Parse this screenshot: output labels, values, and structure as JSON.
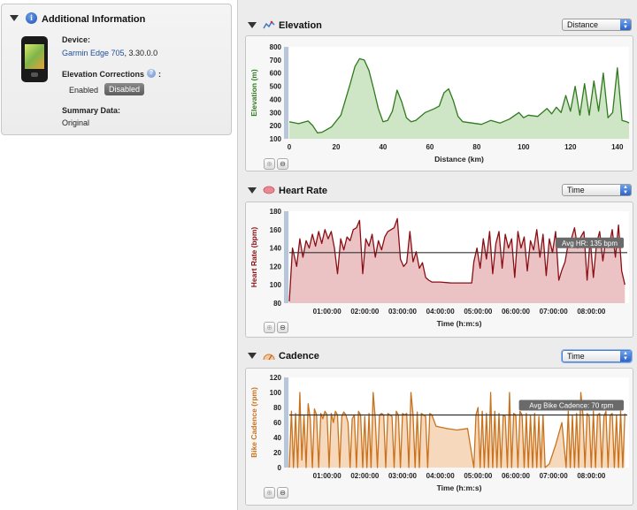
{
  "info": {
    "title": "Additional Information",
    "device_label": "Device:",
    "device_name": "Garmin Edge 705",
    "device_version": ", 3.30.0.0",
    "elevation_corrections_label": "Elevation Corrections",
    "colon": ":",
    "help_glyph": "?",
    "enabled_label": "Enabled",
    "disabled_label": "Disabled",
    "summary_label": "Summary Data:",
    "summary_value": "Original",
    "info_glyph": "i"
  },
  "sections": {
    "elevation": {
      "title": "Elevation",
      "select_value": "Distance"
    },
    "heart_rate": {
      "title": "Heart Rate",
      "select_value": "Time"
    },
    "cadence": {
      "title": "Cadence",
      "select_value": "Time"
    }
  },
  "zoom": {
    "in_glyph": "⊕",
    "out_glyph": "⊖"
  },
  "chart_data": [
    {
      "type": "area",
      "ylabel": "Elevation (m)",
      "xlabel": "Distance (km)",
      "color": "#2f7a1e",
      "fill": "#cfe6c6",
      "xlim": [
        0,
        145
      ],
      "ylim": [
        100,
        800
      ],
      "xticks": [
        0,
        20,
        40,
        60,
        80,
        100,
        120,
        140
      ],
      "yticks": [
        100,
        200,
        300,
        400,
        500,
        600,
        700,
        800
      ],
      "x": [
        0,
        4,
        8,
        10,
        12,
        14,
        18,
        22,
        26,
        28,
        30,
        32,
        34,
        36,
        38,
        40,
        42,
        44,
        46,
        48,
        50,
        52,
        54,
        58,
        62,
        64,
        66,
        68,
        70,
        72,
        74,
        78,
        82,
        86,
        90,
        94,
        98,
        100,
        102,
        106,
        110,
        112,
        114,
        116,
        118,
        120,
        122,
        124,
        126,
        128,
        130,
        132,
        134,
        136,
        138,
        140,
        142,
        144,
        145
      ],
      "values": [
        230,
        215,
        235,
        200,
        145,
        150,
        190,
        280,
        520,
        650,
        710,
        700,
        620,
        480,
        330,
        230,
        240,
        310,
        470,
        380,
        260,
        230,
        240,
        300,
        330,
        350,
        450,
        480,
        390,
        270,
        230,
        220,
        210,
        240,
        220,
        250,
        300,
        260,
        280,
        270,
        330,
        290,
        340,
        300,
        430,
        310,
        500,
        280,
        520,
        280,
        540,
        310,
        600,
        260,
        300,
        640,
        240,
        230,
        220
      ]
    },
    {
      "type": "area",
      "ylabel": "Heart Rate (bpm)",
      "xlabel": "Time (h:m:s)",
      "color": "#8a0e14",
      "fill": "#ecc3c5",
      "xlim": [
        0,
        32400
      ],
      "ylim": [
        80,
        180
      ],
      "xtick_labels": [
        "01:00:00",
        "02:00:00",
        "03:00:00",
        "04:00:00",
        "05:00:00",
        "06:00:00",
        "07:00:00",
        "08:00:00"
      ],
      "xtick_values": [
        3600,
        7200,
        10800,
        14400,
        18000,
        21600,
        25200,
        28800
      ],
      "yticks": [
        80,
        100,
        120,
        140,
        160,
        180
      ],
      "average_value": 135,
      "average_label": "Avg HR: 135 bpm",
      "x": [
        0,
        300,
        700,
        1000,
        1300,
        1600,
        1900,
        2200,
        2500,
        2800,
        3100,
        3400,
        3700,
        4000,
        4300,
        4600,
        4900,
        5200,
        5500,
        5800,
        6100,
        6400,
        6700,
        7000,
        7300,
        7600,
        7900,
        8200,
        8500,
        8800,
        9100,
        9400,
        9700,
        10000,
        10300,
        10600,
        10900,
        11200,
        11500,
        11800,
        12100,
        12400,
        12700,
        13000,
        13300,
        13600,
        14400,
        15400,
        16400,
        17400,
        17600,
        17900,
        18200,
        18500,
        18800,
        19100,
        19400,
        19700,
        20000,
        20300,
        20600,
        20900,
        21200,
        21500,
        21800,
        22100,
        22400,
        22700,
        23000,
        23300,
        23600,
        23900,
        24200,
        24500,
        24800,
        25100,
        25400,
        25700,
        26000,
        26300,
        26600,
        26900,
        27200,
        27500,
        27800,
        28100,
        28400,
        28700,
        29000,
        29300,
        29600,
        29900,
        30200,
        30500,
        30800,
        31100,
        31400,
        31700,
        32000
      ],
      "values": [
        82,
        140,
        120,
        150,
        130,
        148,
        140,
        155,
        142,
        158,
        145,
        160,
        150,
        158,
        140,
        112,
        150,
        138,
        152,
        148,
        160,
        162,
        170,
        112,
        150,
        142,
        155,
        130,
        148,
        138,
        152,
        158,
        160,
        162,
        172,
        128,
        120,
        124,
        158,
        125,
        136,
        118,
        124,
        108,
        105,
        103,
        103,
        102,
        102,
        102,
        125,
        140,
        118,
        150,
        128,
        158,
        112,
        145,
        158,
        118,
        155,
        140,
        150,
        108,
        158,
        140,
        152,
        115,
        148,
        138,
        160,
        130,
        155,
        110,
        150,
        135,
        158,
        105,
        116,
        125,
        145,
        150,
        162,
        140,
        152,
        158,
        105,
        150,
        108,
        145,
        158,
        126,
        150,
        142,
        160,
        130,
        165,
        115,
        100
      ]
    },
    {
      "type": "area",
      "ylabel": "Bike Cadence (rpm)",
      "xlabel": "Time (h:m:s)",
      "color": "#c9721b",
      "fill": "#f6d9bd",
      "xlim": [
        0,
        32400
      ],
      "ylim": [
        0,
        120
      ],
      "xtick_labels": [
        "01:00:00",
        "02:00:00",
        "03:00:00",
        "04:00:00",
        "05:00:00",
        "06:00:00",
        "07:00:00",
        "08:00:00"
      ],
      "xtick_values": [
        3600,
        7200,
        10800,
        14400,
        18000,
        21600,
        25200,
        28800
      ],
      "yticks": [
        0,
        20,
        40,
        60,
        80,
        100,
        120
      ],
      "average_value": 70,
      "average_label": "Avg Bike Cadence: 70 rpm",
      "x": [
        0,
        200,
        400,
        600,
        800,
        1000,
        1200,
        1400,
        1600,
        1800,
        2000,
        2200,
        2400,
        2600,
        2800,
        3000,
        3200,
        3400,
        3600,
        3800,
        4000,
        4200,
        4400,
        4600,
        4800,
        5000,
        5200,
        5400,
        5600,
        5800,
        6000,
        6200,
        6400,
        6600,
        6800,
        7000,
        7200,
        7400,
        7600,
        7800,
        8000,
        8200,
        8400,
        8600,
        8800,
        9000,
        9200,
        9400,
        9600,
        9800,
        10000,
        10200,
        10400,
        10600,
        10800,
        11000,
        11200,
        11400,
        11600,
        11800,
        12000,
        12200,
        12400,
        12600,
        12800,
        13000,
        13200,
        13400,
        13600,
        14000,
        15000,
        16000,
        17000,
        17600,
        17800,
        18000,
        18200,
        18400,
        18600,
        18800,
        19000,
        19200,
        19400,
        19600,
        19800,
        20000,
        20200,
        20400,
        20600,
        20800,
        21000,
        21200,
        21400,
        21600,
        21800,
        22000,
        22200,
        22400,
        22600,
        22800,
        23000,
        23200,
        23400,
        23600,
        23800,
        24000,
        24200,
        24400,
        24800,
        25400,
        26000,
        26400,
        26600,
        26800,
        27000,
        27200,
        27400,
        27600,
        27800,
        28000,
        28200,
        28400,
        28600,
        28800,
        29000,
        29200,
        29400,
        29600,
        29800,
        30000,
        30200,
        30400,
        30600,
        30800,
        31000,
        31200,
        31400,
        31600,
        31800,
        32000
      ],
      "values": [
        0,
        75,
        0,
        72,
        0,
        100,
        10,
        70,
        0,
        85,
        65,
        0,
        78,
        70,
        0,
        72,
        65,
        75,
        70,
        0,
        72,
        60,
        75,
        70,
        0,
        68,
        74,
        70,
        60,
        0,
        65,
        70,
        0,
        75,
        70,
        0,
        68,
        0,
        72,
        0,
        100,
        65,
        0,
        70,
        72,
        70,
        0,
        72,
        70,
        68,
        0,
        75,
        70,
        0,
        72,
        70,
        72,
        0,
        100,
        70,
        0,
        74,
        0,
        72,
        70,
        68,
        0,
        72,
        70,
        55,
        52,
        50,
        52,
        0,
        70,
        80,
        0,
        75,
        0,
        72,
        0,
        100,
        0,
        75,
        0,
        72,
        0,
        70,
        68,
        0,
        100,
        0,
        72,
        70,
        0,
        75,
        70,
        0,
        72,
        0,
        70,
        0,
        72,
        0,
        68,
        0,
        70,
        0,
        5,
        30,
        60,
        0,
        75,
        0,
        70,
        0,
        72,
        0,
        100,
        70,
        0,
        72,
        68,
        0,
        75,
        0,
        70,
        72,
        0,
        68,
        75,
        0,
        70,
        72,
        0,
        70,
        0,
        75,
        0,
        72
      ]
    }
  ]
}
